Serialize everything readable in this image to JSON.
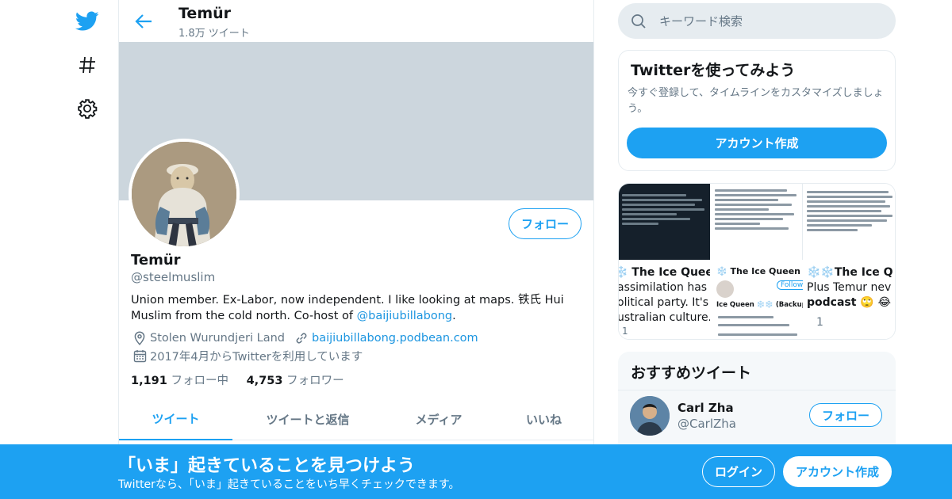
{
  "nav": {
    "icons": [
      "twitter-bird-icon",
      "hashtag-icon",
      "settings-gear-icon"
    ]
  },
  "header": {
    "name": "Temür",
    "tweet_count": "1.8万 ツイート"
  },
  "profile": {
    "name": "Temür",
    "handle": "@steelmuslim",
    "follow_label": "フォロー",
    "bio_text": "Union member. Ex-Labor, now independent. I like looking at maps. 铁氏 Hui Muslim from the cold north. Co-host of ",
    "bio_link": "@baijiubillabong",
    "bio_end": ".",
    "location": "Stolen Wurundjeri Land",
    "website": "baijiubillabong.podbean.com",
    "joined": "2017年4月からTwitterを利用しています",
    "following_count": "1,191",
    "following_label": "フォロー中",
    "followers_count": "4,753",
    "followers_label": "フォロワー"
  },
  "tabs": [
    {
      "label": "ツイート",
      "active": true
    },
    {
      "label": "ツイートと返信"
    },
    {
      "label": "メディア"
    },
    {
      "label": "いいね"
    }
  ],
  "search": {
    "placeholder": "キーワード検索"
  },
  "signup_card": {
    "title": "Twitterを使ってみよう",
    "description": "今すぐ登録して、タイムラインをカスタマイズしましょう。",
    "button": "アカウント作成"
  },
  "media_grid": {
    "tile4_title": "❄️ The Ice Queen",
    "tile4_line1": "assimilation has nothin",
    "tile4_line2": "olitical party. It's more",
    "tile4_line3": "ustralian culture.",
    "tile4_count": "1",
    "tile5_title": "❄️ The Ice Queen ❄️",
    "tile5_follow": "Follow",
    "tile5_backup": "Ice Queen ❄️❄️ (Backup)",
    "tile6_title": "❄️❄️The Ice Q",
    "tile6_line1": "Plus Temur nev",
    "tile6_line2": "podcast 🙄 😂",
    "tile6_count": "1"
  },
  "recommended": {
    "title": "おすすめツイート",
    "user_name": "Carl Zha",
    "user_handle": "@CarlZha",
    "follow_label": "フォロー"
  },
  "bottom_bar": {
    "title": "「いま」起きていることを見つけよう",
    "subtitle": "Twitterなら、「いま」起きていることをいち早くチェックできます。",
    "login": "ログイン",
    "signup": "アカウント作成"
  },
  "colors": {
    "accent": "#1da1f2",
    "banner": "#ccd6dd",
    "muted": "#657786"
  }
}
